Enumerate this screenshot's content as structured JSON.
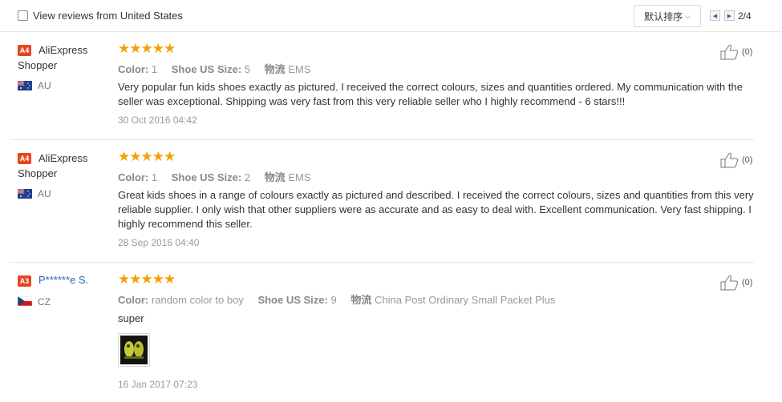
{
  "toolbar": {
    "filter_label": "View reviews from United States",
    "sort_label": "默认排序",
    "page_indicator": "2/4"
  },
  "reviews": [
    {
      "badge": "A4",
      "badge_color": "#e5461f",
      "user": "AliExpress Shopper",
      "user_is_link": false,
      "country": "AU",
      "flag": "australia-flag-icon",
      "rating": 5,
      "stars": "★★★★★",
      "color_key": "Color:",
      "color_val": "1",
      "size_key": "Shoe US Size:",
      "size_val": "5",
      "ship_key": "物流",
      "ship_val": "EMS",
      "text": "Very popular fun kids shoes exactly as pictured. I received the correct colours, sizes and quantities ordered. My communication with the seller was exceptional. Shipping was very fast from this very reliable seller who I highly recommend - 6 stars!!!",
      "date": "30 Oct 2016 04:42",
      "likes": "(0)"
    },
    {
      "badge": "A4",
      "badge_color": "#e5461f",
      "user": "AliExpress Shopper",
      "user_is_link": false,
      "country": "AU",
      "flag": "australia-flag-icon",
      "rating": 5,
      "stars": "★★★★★",
      "color_key": "Color:",
      "color_val": "1",
      "size_key": "Shoe US Size:",
      "size_val": "2",
      "ship_key": "物流",
      "ship_val": "EMS",
      "text": "Great kids shoes in a range of colours exactly as pictured and described. I received the correct colours, sizes and quantities from this very reliable supplier. I only wish that other suppliers were as accurate and as easy to deal with. Excellent communication. Very fast shipping. I highly recommend this seller.",
      "date": "28 Sep 2016 04:40",
      "likes": "(0)"
    },
    {
      "badge": "A3",
      "badge_color": "#e5461f",
      "user": "P******e S.",
      "user_is_link": true,
      "country": "CZ",
      "flag": "czech-flag-icon",
      "rating": 5,
      "stars": "★★★★★",
      "color_key": "Color:",
      "color_val": "random color to boy",
      "size_key": "Shoe US Size:",
      "size_val": "9",
      "ship_key": "物流",
      "ship_val": "China Post Ordinary Small Packet Plus",
      "text": "super",
      "date": "16 Jan 2017 07:23",
      "likes": "(0)",
      "has_photo": true
    }
  ]
}
